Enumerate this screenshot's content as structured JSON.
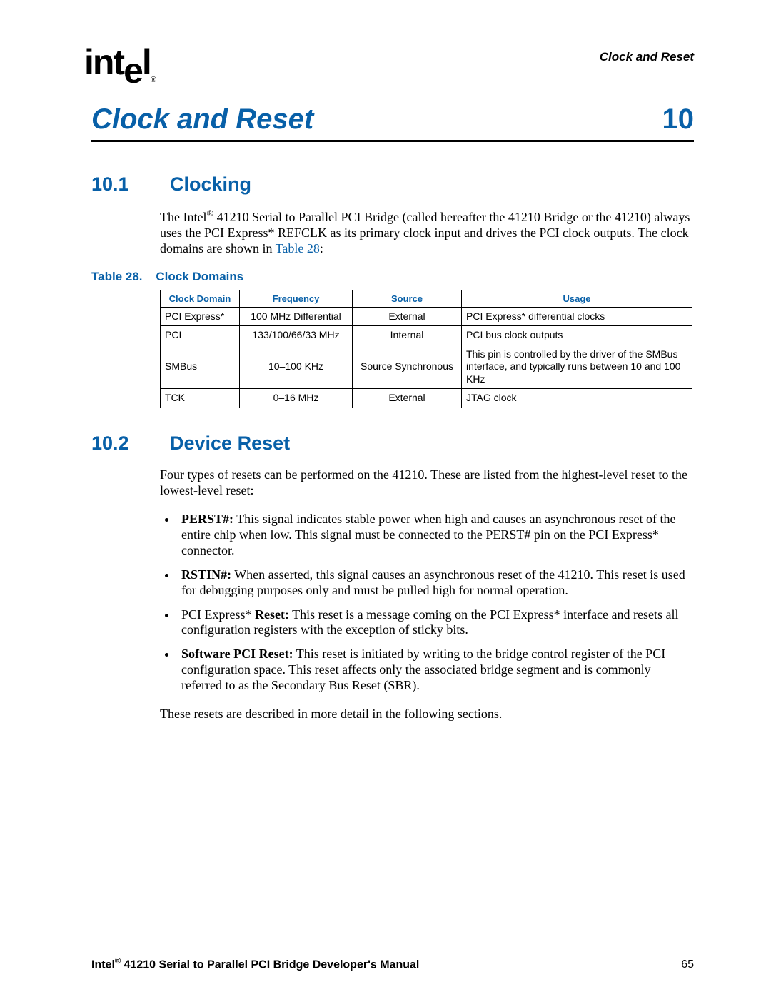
{
  "header": {
    "running_head": "Clock and Reset",
    "logo_text": "int",
    "logo_e": "e",
    "logo_l": "l",
    "logo_reg": "®"
  },
  "chapter": {
    "title": "Clock and Reset",
    "number": "10"
  },
  "section1": {
    "number": "10.1",
    "title": "Clocking",
    "para_pre": "The Intel",
    "para_reg": "®",
    "para_mid": " 41210 Serial to Parallel PCI Bridge (called hereafter the 41210 Bridge or the 41210) always uses the PCI Express* REFCLK as its primary clock input and drives the PCI clock outputs. The clock domains are shown in ",
    "para_link": "Table 28",
    "para_post": ":",
    "table_caption_label": "Table 28.",
    "table_caption_title": "Clock Domains",
    "table_headers": [
      "Clock Domain",
      "Frequency",
      "Source",
      "Usage"
    ],
    "rows": [
      {
        "domain": "PCI Express*",
        "freq": "100 MHz Differential",
        "source": "External",
        "usage": "PCI Express* differential clocks"
      },
      {
        "domain": "PCI",
        "freq": "133/100/66/33 MHz",
        "source": "Internal",
        "usage": "PCI bus clock outputs"
      },
      {
        "domain": "SMBus",
        "freq": "10–100 KHz",
        "source": "Source Synchronous",
        "usage": "This pin is controlled by the driver of the SMBus interface, and typically runs between 10 and 100 KHz"
      },
      {
        "domain": "TCK",
        "freq": "0–16 MHz",
        "source": "External",
        "usage": "JTAG clock"
      }
    ]
  },
  "section2": {
    "number": "10.2",
    "title": "Device Reset",
    "intro": "Four types of resets can be performed on the 41210. These are listed from the highest-level reset to the lowest-level reset:",
    "items": [
      {
        "label": "PERST#:",
        "text": " This signal indicates stable power when high and causes an asynchronous reset of the entire chip when low. This signal must be connected to the PERST# pin on the PCI Express* connector."
      },
      {
        "label": "RSTIN#:",
        "text": " When asserted, this signal causes an asynchronous reset of the 41210. This reset is used for debugging purposes only and must be pulled high for normal operation."
      },
      {
        "label": "PCI Express* Reset:",
        "pre": "PCI Express* ",
        "bold": "Reset:",
        "text": " This reset is a message coming on the PCI Express* interface and resets all configuration registers with the exception of sticky bits."
      },
      {
        "label": "Software PCI Reset:",
        "text": " This reset is initiated by writing to the bridge control register of the PCI configuration space. This reset affects only the associated bridge segment and is commonly referred to as the Secondary Bus Reset (SBR)."
      }
    ],
    "outro": "These resets are described in more detail in the following sections."
  },
  "footer": {
    "manual_pre": "Intel",
    "manual_reg": "®",
    "manual_post": " 41210 Serial to Parallel PCI Bridge Developer's Manual",
    "page_number": "65"
  }
}
